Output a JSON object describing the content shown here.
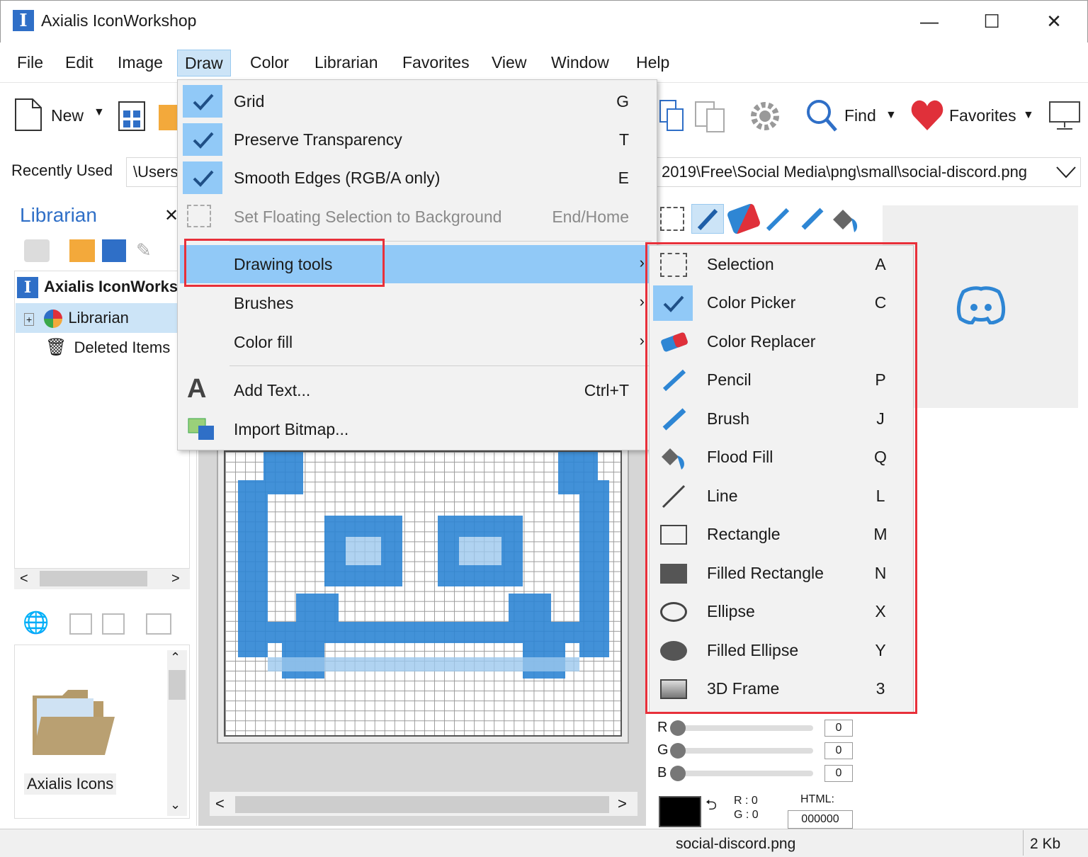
{
  "window": {
    "title": "Axialis IconWorkshop",
    "minimize": "—",
    "maximize": "☐",
    "close": "✕"
  },
  "menubar": [
    "File",
    "Edit",
    "Image",
    "Draw",
    "Color",
    "Librarian",
    "Favorites",
    "View",
    "Window",
    "Help"
  ],
  "toolbar": {
    "new_label": "New",
    "find_label": "Find",
    "favorites_label": "Favorites"
  },
  "recent": {
    "label": "Recently Used",
    "path_left": "\\Users",
    "path_right": "2019\\Free\\Social Media\\png\\small\\social-discord.png"
  },
  "librarian": {
    "title": "Librarian",
    "tree": [
      {
        "label": "Axialis IconWorkshop"
      },
      {
        "label": "Librarian"
      },
      {
        "label": "Deleted Items"
      }
    ],
    "folder_label": "Axialis Icons"
  },
  "draw_menu": {
    "items": [
      {
        "label": "Grid",
        "shortcut": "G"
      },
      {
        "label": "Preserve Transparency",
        "shortcut": "T"
      },
      {
        "label": "Smooth Edges (RGB/A only)",
        "shortcut": "E"
      },
      {
        "label": "Set Floating Selection to Background",
        "shortcut": "End/Home"
      },
      {
        "label": "Drawing tools"
      },
      {
        "label": "Brushes"
      },
      {
        "label": "Color fill"
      },
      {
        "label": "Add Text...",
        "shortcut": "Ctrl+T"
      },
      {
        "label": "Import Bitmap..."
      }
    ]
  },
  "drawing_tools": [
    {
      "label": "Selection",
      "shortcut": "A"
    },
    {
      "label": "Color Picker",
      "shortcut": "C"
    },
    {
      "label": "Color Replacer",
      "shortcut": ""
    },
    {
      "label": "Pencil",
      "shortcut": "P"
    },
    {
      "label": "Brush",
      "shortcut": "J"
    },
    {
      "label": "Flood Fill",
      "shortcut": "Q"
    },
    {
      "label": "Line",
      "shortcut": "L"
    },
    {
      "label": "Rectangle",
      "shortcut": "M"
    },
    {
      "label": "Filled Rectangle",
      "shortcut": "N"
    },
    {
      "label": "Ellipse",
      "shortcut": "X"
    },
    {
      "label": "Filled Ellipse",
      "shortcut": "Y"
    },
    {
      "label": "3D Frame",
      "shortcut": "3"
    }
  ],
  "color_panel": {
    "r_label": "R",
    "g_label": "G",
    "b_label": "B",
    "r": "0",
    "g": "0",
    "b": "0",
    "html_label": "HTML:",
    "html_value": "000000",
    "r_text": "R :  0",
    "g_text": "G :  0"
  },
  "status": {
    "filename": "social-discord.png",
    "size": "2 Kb"
  },
  "colors": {
    "accent": "#2f6fc7",
    "menu_highlight": "#91c9f7",
    "callout_red": "#e8303a"
  }
}
